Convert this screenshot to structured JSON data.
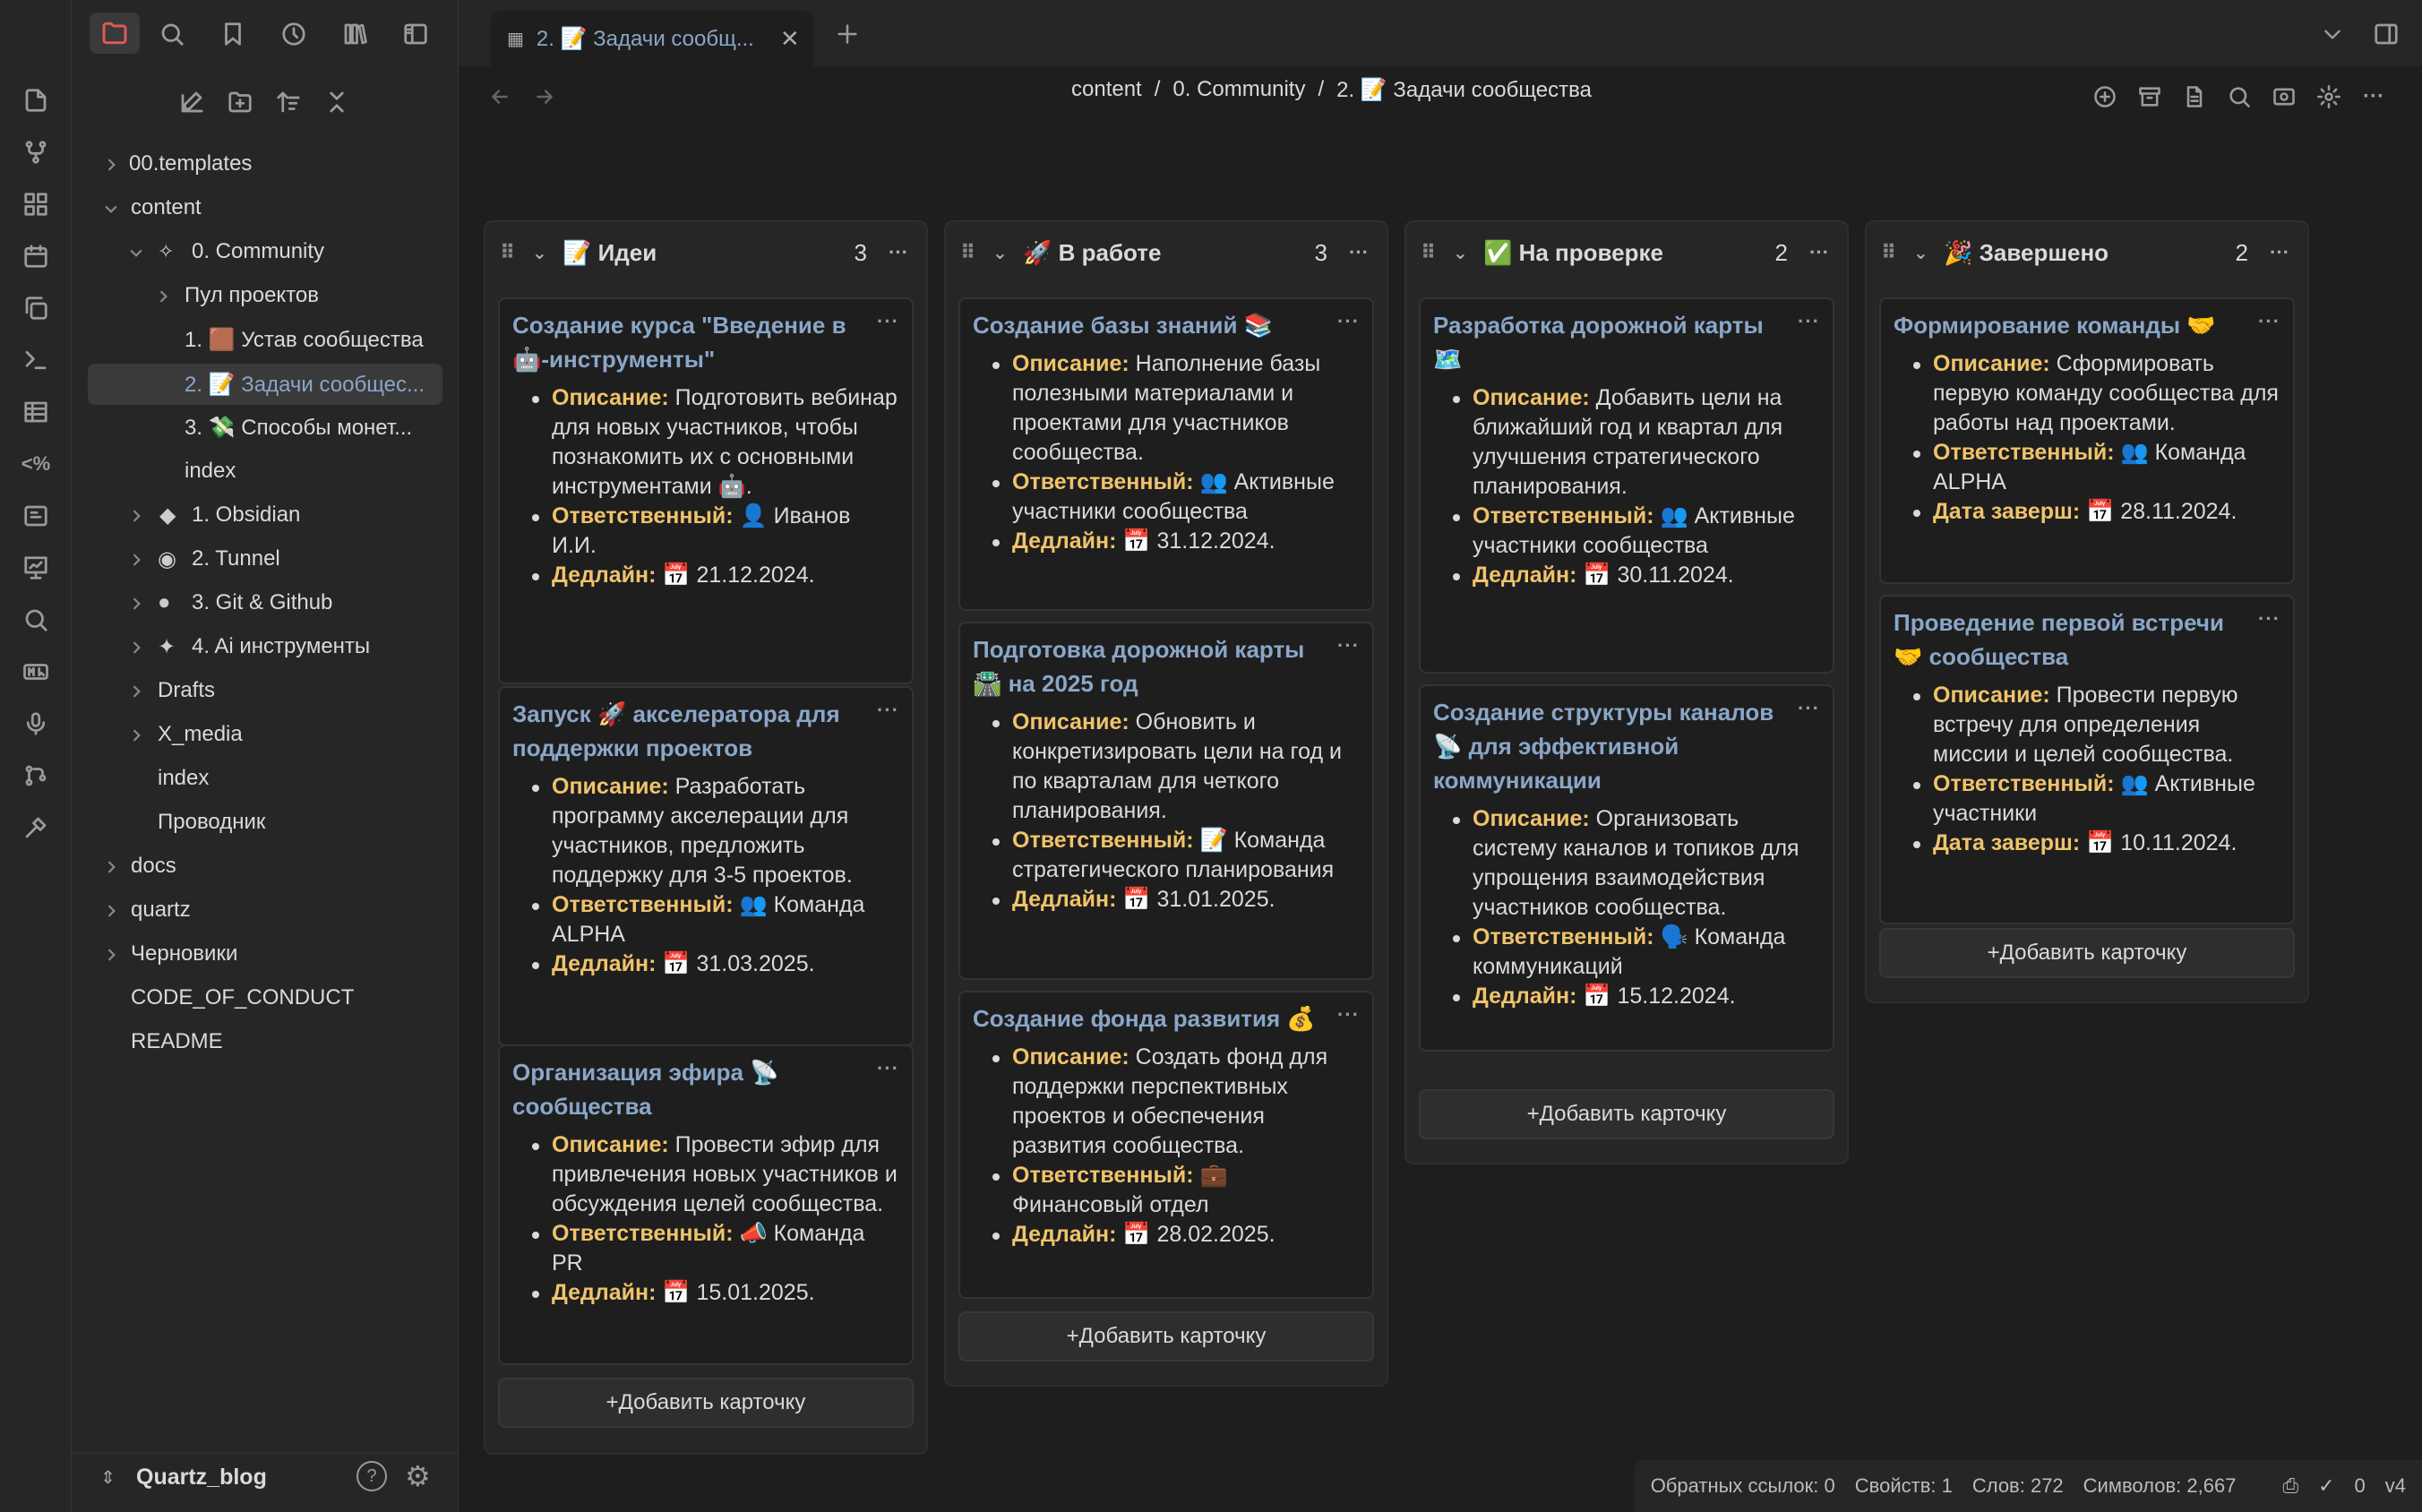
{
  "colors": {
    "accent": "#8aa6c8",
    "label": "#f0c36b",
    "folder_active": "#e05a5a"
  },
  "tab": {
    "label": "2. 📝 Задачи сообщ..."
  },
  "breadcrumb": {
    "part1": "content",
    "sep": "/",
    "part2": "0. Community",
    "part3": "2. 📝 Задачи сообщества"
  },
  "sidebar": {
    "vault_name": "Quartz_blog",
    "items": [
      {
        "label": "00.templates"
      },
      {
        "label": "content"
      },
      {
        "label": "0. Community"
      },
      {
        "label": "Пул проектов"
      },
      {
        "label": "1. 🟫 Устав сообщества"
      },
      {
        "label": "2. 📝 Задачи сообщес..."
      },
      {
        "label": "3. 💸 Способы монет..."
      },
      {
        "label": "index"
      },
      {
        "label": "1. Obsidian"
      },
      {
        "label": "2. Tunnel"
      },
      {
        "label": "3. Git & Github"
      },
      {
        "label": "4. Ai инструменты"
      },
      {
        "label": "Drafts"
      },
      {
        "label": "X_media"
      },
      {
        "label": "index"
      },
      {
        "label": "Проводник"
      },
      {
        "label": "docs"
      },
      {
        "label": "quartz"
      },
      {
        "label": "Черновики"
      },
      {
        "label": "CODE_OF_CONDUCT"
      },
      {
        "label": "README"
      }
    ]
  },
  "labels": {
    "desc": "Описание:",
    "resp": "Ответственный:",
    "deadline": "Дедлайн:",
    "done": "Дата заверш:",
    "add_card": "+Добавить карточку"
  },
  "lanes": [
    {
      "title": "📝 Идеи",
      "count": "3",
      "cards": [
        {
          "title": "Создание курса \"Введение в 🤖-инструменты\"",
          "desc": " Подготовить вебинар для новых участников, чтобы познакомить их с основными инструментами 🤖.",
          "resp": " 👤 Иванов И.И.",
          "date": " 📅 21.12.2024."
        },
        {
          "title": "Запуск 🚀 акселератора для поддержки проектов",
          "desc": " Разработать программу акселерации для участников, предложить поддержку для 3-5 проектов.",
          "resp": " 👥 Команда ALPHA",
          "date": " 📅 31.03.2025."
        },
        {
          "title": "Организация эфира 📡 сообщества",
          "desc": " Провести эфир для привлечения новых участников и обсуждения целей сообщества.",
          "resp": " 📣 Команда PR",
          "date": " 📅 15.01.2025."
        }
      ]
    },
    {
      "title": "🚀 В работе",
      "count": "3",
      "cards": [
        {
          "title": "Создание базы знаний 📚",
          "desc": " Наполнение базы полезными материалами и проектами для участников сообщества.",
          "resp": " 👥 Активные участники сообщества",
          "date": " 📅 31.12.2024."
        },
        {
          "title": "Подготовка дорожной карты 🛣️ на 2025 год",
          "desc": " Обновить и конкретизировать цели на год и по кварталам для четкого планирования.",
          "resp": " 📝 Команда стратегического планирования",
          "date": " 📅 31.01.2025."
        },
        {
          "title": "Создание фонда развития 💰",
          "desc": " Создать фонд для поддержки перспективных проектов и обеспечения развития сообщества.",
          "resp": " 💼 Финансовый отдел",
          "date": " 📅 28.02.2025."
        }
      ]
    },
    {
      "title": "✅ На проверке",
      "count": "2",
      "cards": [
        {
          "title": "Разработка дорожной карты 🗺️",
          "desc": " Добавить цели на ближайший год и квартал для улучшения стратегического планирования.",
          "resp": " 👥 Активные участники сообщества",
          "date": " 📅 30.11.2024."
        },
        {
          "title": "Создание структуры каналов 📡 для эффективной коммуникации",
          "desc": " Организовать систему каналов и топиков для упрощения взаимодействия участников сообщества.",
          "resp": " 🗣️ Команда коммуникаций",
          "date": " 📅 15.12.2024."
        }
      ]
    },
    {
      "title": "🎉 Завершено",
      "count": "2",
      "cards": [
        {
          "title": "Формирование команды 🤝",
          "desc": " Сформировать первую команду сообщества для работы над проектами.",
          "resp": " 👥 Команда ALPHA",
          "date": " 📅 28.11.2024."
        },
        {
          "title": "Проведение первой встречи 🤝 сообщества",
          "desc": " Провести первую встречу для определения миссии и целей сообщества.",
          "resp": " 👥 Активные участники",
          "date": " 📅 10.11.2024."
        }
      ]
    }
  ],
  "status": {
    "backlinks": "Обратных ссылок: 0",
    "props": "Свойств: 1",
    "words": "Слов: 272",
    "chars": "Символов: 2,667",
    "sync": "0",
    "version": "v4"
  }
}
